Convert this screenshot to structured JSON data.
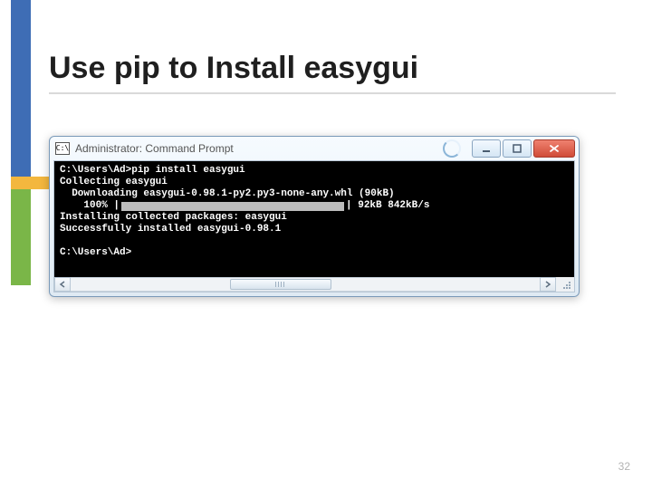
{
  "slide": {
    "title": "Use pip to Install easygui",
    "page_number": "32"
  },
  "window": {
    "icon_label": "C:\\",
    "title": "Administrator: Command Prompt"
  },
  "console": {
    "line1": "C:\\Users\\Ad>pip install easygui",
    "line2": "Collecting easygui",
    "line3": "  Downloading easygui-0.98.1-py2.py3-none-any.whl (90kB)",
    "line4_left": "    100% |",
    "line4_right": "| 92kB 842kB/s",
    "line5": "Installing collected packages: easygui",
    "line6": "Successfully installed easygui-0.98.1",
    "line7": "",
    "line8": "C:\\Users\\Ad>"
  }
}
